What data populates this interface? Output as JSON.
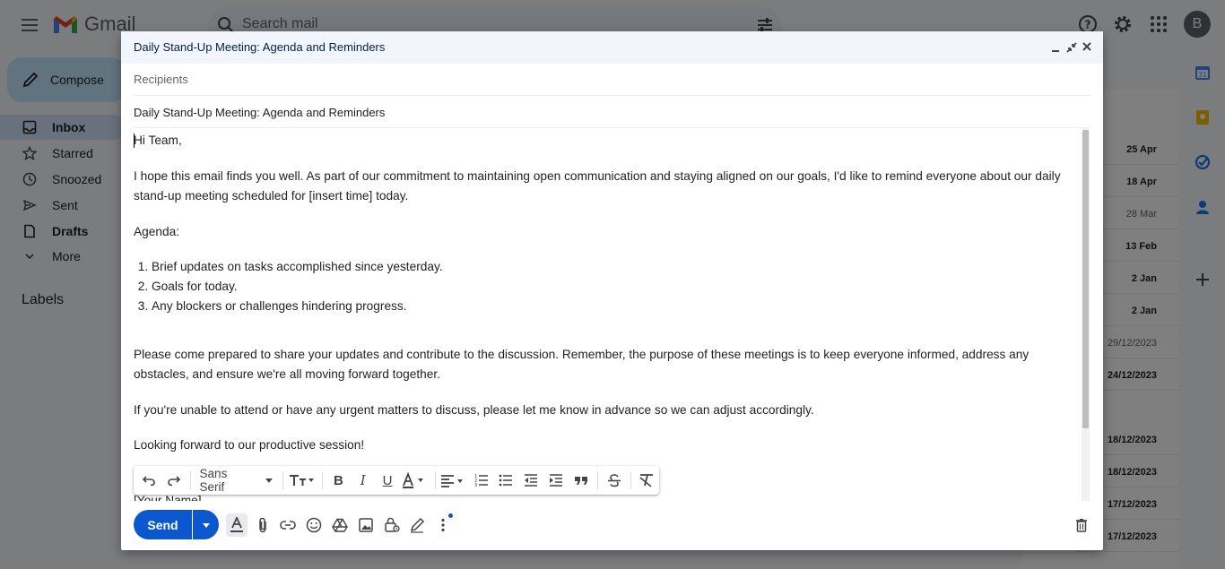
{
  "app": {
    "name": "Gmail",
    "avatar_letter": "B"
  },
  "search": {
    "placeholder": "Search mail"
  },
  "compose_button": "Compose",
  "nav": [
    {
      "label": "Inbox",
      "icon": "inbox-icon",
      "active": true
    },
    {
      "label": "Starred",
      "icon": "star-icon"
    },
    {
      "label": "Snoozed",
      "icon": "clock-icon"
    },
    {
      "label": "Sent",
      "icon": "send-icon"
    },
    {
      "label": "Drafts",
      "icon": "draft-icon",
      "bold": true
    },
    {
      "label": "More",
      "icon": "chevron-down-icon"
    }
  ],
  "labels_heading": "Labels",
  "list_dates": [
    {
      "text": "25 Apr",
      "read": false
    },
    {
      "text": "18 Apr",
      "read": false
    },
    {
      "text": "28 Mar",
      "read": true
    },
    {
      "text": "13 Feb",
      "read": false
    },
    {
      "text": "2 Jan",
      "read": false
    },
    {
      "text": "2 Jan",
      "read": false
    },
    {
      "text": "29/12/2023",
      "read": true
    },
    {
      "text": "24/12/2023",
      "read": false
    },
    {
      "text": "18/12/2023",
      "read": false
    },
    {
      "text": "18/12/2023",
      "read": false
    },
    {
      "text": "17/12/2023",
      "read": false
    },
    {
      "text": "17/12/2023",
      "read": false
    }
  ],
  "compose": {
    "title": "Daily Stand-Up Meeting: Agenda and Reminders",
    "recipients_placeholder": "Recipients",
    "subject": "Daily Stand-Up Meeting: Agenda and Reminders",
    "body": {
      "greeting": "Hi Team,",
      "intro": "I hope this email finds you well. As part of our commitment to maintaining open communication and staying aligned on our goals, I'd like to remind everyone about our daily stand-up meeting scheduled for [insert time] today.",
      "agenda_label": "Agenda:",
      "agenda_items": [
        "Brief updates on tasks accomplished since yesterday.",
        "Goals for today.",
        "Any blockers or challenges hindering progress."
      ],
      "para2": "Please come prepared to share your updates and contribute to the discussion. Remember, the purpose of these meetings is to keep everyone informed, address any obstacles, and ensure we're all moving forward together.",
      "para3": "If you're unable to attend or have any urgent matters to discuss, please let me know in advance so we can adjust accordingly.",
      "closing": "Looking forward to our productive session!",
      "signature": "[Your Name]"
    },
    "font_family": "Sans Serif",
    "send_label": "Send"
  },
  "colors": {
    "accent": "#0b57d0",
    "compose_bg": "#c2e7ff"
  }
}
